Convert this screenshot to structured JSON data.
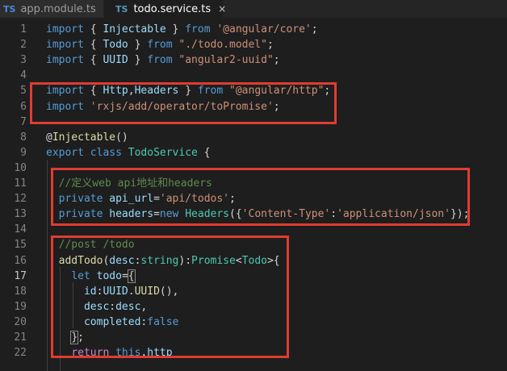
{
  "tabs": [
    {
      "icon": "TS",
      "label": "app.module.ts"
    },
    {
      "icon": "TS",
      "label": "todo.service.ts",
      "close": "×"
    }
  ],
  "lines": [
    {
      "n": "1",
      "tokens": [
        [
          "kw",
          "import"
        ],
        [
          "pl",
          " { "
        ],
        [
          "prop",
          "Injectable"
        ],
        [
          "pl",
          " } "
        ],
        [
          "kw",
          "from"
        ],
        [
          "pl",
          " "
        ],
        [
          "str",
          "'@angular/core'"
        ],
        [
          "pl",
          ";"
        ]
      ]
    },
    {
      "n": "2",
      "tokens": [
        [
          "kw",
          "import"
        ],
        [
          "pl",
          " { "
        ],
        [
          "prop",
          "Todo"
        ],
        [
          "pl",
          " } "
        ],
        [
          "kw",
          "from"
        ],
        [
          "pl",
          " "
        ],
        [
          "str",
          "\"./todo.model\""
        ],
        [
          "pl",
          ";"
        ]
      ]
    },
    {
      "n": "3",
      "tokens": [
        [
          "kw",
          "import"
        ],
        [
          "pl",
          " { "
        ],
        [
          "prop",
          "UUID"
        ],
        [
          "pl",
          " } "
        ],
        [
          "kw",
          "from"
        ],
        [
          "pl",
          " "
        ],
        [
          "str",
          "\"angular2-uuid\""
        ],
        [
          "pl",
          ";"
        ]
      ]
    },
    {
      "n": "4",
      "tokens": []
    },
    {
      "n": "5",
      "tokens": [
        [
          "kw",
          "import"
        ],
        [
          "pl",
          " { "
        ],
        [
          "prop",
          "Http"
        ],
        [
          "pl",
          ","
        ],
        [
          "prop",
          "Headers"
        ],
        [
          "pl",
          " } "
        ],
        [
          "kw",
          "from"
        ],
        [
          "pl",
          " "
        ],
        [
          "str",
          "\"@angular/http\""
        ],
        [
          "pl",
          ";"
        ]
      ]
    },
    {
      "n": "6",
      "tokens": [
        [
          "kw",
          "import"
        ],
        [
          "pl",
          " "
        ],
        [
          "str",
          "'rxjs/add/operator/toPromise'"
        ],
        [
          "pl",
          ";"
        ]
      ]
    },
    {
      "n": "7",
      "tokens": []
    },
    {
      "n": "8",
      "tokens": [
        [
          "pl",
          "@"
        ],
        [
          "fn",
          "Injectable"
        ],
        [
          "pl",
          "()"
        ]
      ]
    },
    {
      "n": "9",
      "tokens": [
        [
          "kw",
          "export"
        ],
        [
          "pl",
          " "
        ],
        [
          "kw",
          "class"
        ],
        [
          "pl",
          " "
        ],
        [
          "cls",
          "TodoService"
        ],
        [
          "pl",
          " {"
        ]
      ]
    },
    {
      "n": "10",
      "tokens": []
    },
    {
      "n": "11",
      "tokens": [
        [
          "pl",
          "  "
        ],
        [
          "com",
          "//定义web api地址和headers"
        ]
      ]
    },
    {
      "n": "12",
      "tokens": [
        [
          "pl",
          "  "
        ],
        [
          "kw",
          "private"
        ],
        [
          "pl",
          " "
        ],
        [
          "prop",
          "api_url"
        ],
        [
          "pl",
          "="
        ],
        [
          "str",
          "'api/todos'"
        ],
        [
          "pl",
          ";"
        ]
      ]
    },
    {
      "n": "13",
      "tokens": [
        [
          "pl",
          "  "
        ],
        [
          "kw",
          "private"
        ],
        [
          "pl",
          " "
        ],
        [
          "prop",
          "headers"
        ],
        [
          "pl",
          "="
        ],
        [
          "kw",
          "new"
        ],
        [
          "pl",
          " "
        ],
        [
          "cls",
          "Headers"
        ],
        [
          "pl",
          "({"
        ],
        [
          "str",
          "'Content-Type'"
        ],
        [
          "pl",
          ":"
        ],
        [
          "str",
          "'application/json'"
        ],
        [
          "pl",
          "});"
        ]
      ]
    },
    {
      "n": "14",
      "tokens": []
    },
    {
      "n": "15",
      "tokens": [
        [
          "pl",
          "  "
        ],
        [
          "com",
          "//post /todo"
        ]
      ]
    },
    {
      "n": "16",
      "tokens": [
        [
          "pl",
          "  "
        ],
        [
          "fn",
          "addTodo"
        ],
        [
          "pl",
          "("
        ],
        [
          "prop",
          "desc"
        ],
        [
          "pl",
          ":"
        ],
        [
          "cls",
          "string"
        ],
        [
          "pl",
          "):"
        ],
        [
          "cls",
          "Promise"
        ],
        [
          "pl",
          "<"
        ],
        [
          "cls",
          "Todo"
        ],
        [
          "pl",
          ">{"
        ]
      ]
    },
    {
      "n": "17",
      "tokens": [
        [
          "pl",
          "    "
        ],
        [
          "kw",
          "let"
        ],
        [
          "pl",
          " "
        ],
        [
          "prop",
          "todo"
        ],
        [
          "pl",
          "="
        ],
        [
          "pl",
          "{",
          "bracket"
        ]
      ]
    },
    {
      "n": "18",
      "tokens": [
        [
          "pl",
          "      "
        ],
        [
          "prop",
          "id"
        ],
        [
          "pl",
          ":"
        ],
        [
          "prop",
          "UUID"
        ],
        [
          "pl",
          "."
        ],
        [
          "fn",
          "UUID"
        ],
        [
          "pl",
          "(),"
        ]
      ]
    },
    {
      "n": "19",
      "tokens": [
        [
          "pl",
          "      "
        ],
        [
          "prop",
          "desc"
        ],
        [
          "pl",
          ":"
        ],
        [
          "prop",
          "desc"
        ],
        [
          "pl",
          ","
        ]
      ]
    },
    {
      "n": "20",
      "tokens": [
        [
          "pl",
          "      "
        ],
        [
          "prop",
          "completed"
        ],
        [
          "pl",
          ":"
        ],
        [
          "kw",
          "false"
        ]
      ]
    },
    {
      "n": "21",
      "tokens": [
        [
          "pl",
          "    "
        ],
        [
          "pl",
          "}",
          "bracket"
        ],
        [
          "pl",
          ";"
        ]
      ]
    },
    {
      "n": "22",
      "tokens": [
        [
          "pl",
          "    "
        ],
        [
          "kw2",
          "return"
        ],
        [
          "pl",
          " "
        ],
        [
          "kw",
          "this"
        ],
        [
          "pl",
          "."
        ],
        [
          "prop",
          "http"
        ]
      ]
    }
  ],
  "active_line": "17",
  "colors": {
    "highlight_border": "#e03c31",
    "background": "#1e1e1e"
  }
}
